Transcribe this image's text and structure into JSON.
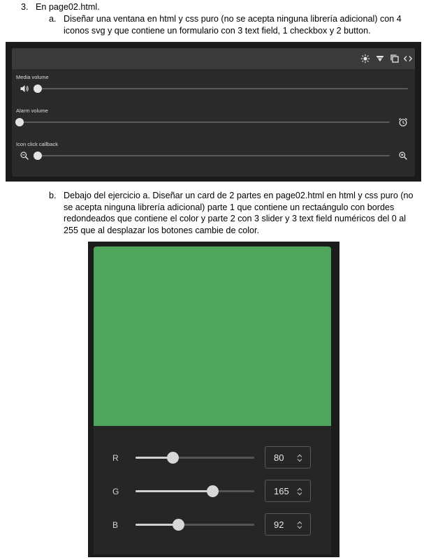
{
  "item3": {
    "marker": "3.",
    "text": "En page02.html."
  },
  "item_a": {
    "marker": "a.",
    "text": "Diseñar una ventana en html y css puro (no se acepta ninguna librería adicional) con 4 iconos svg y que contiene un formulario con 3 text field, 1 checkbox y 2 button."
  },
  "window_a": {
    "toolbar_icons": [
      "brightness-icon",
      "download-icon",
      "copy-icon",
      "code-icon"
    ],
    "rows": [
      {
        "label": "Media volume",
        "leading_icon": "volume-icon",
        "value": 0.05
      },
      {
        "label": "Alarm volume",
        "trailing_icon": "alarm-clock-icon",
        "value": 0.0
      },
      {
        "label": "Icon click callback",
        "leading_icon": "zoom-out-icon",
        "trailing_icon": "zoom-in-icon",
        "value": 0.0
      }
    ]
  },
  "item_b": {
    "marker": "b.",
    "text": "Debajo del ejercicio a. Diseñar un card de 2 partes en page02.html en html y css puro (no se acepta ninguna librería adicional) parte 1 que contiene un rectaángulo con bordes redondeados que contiene el color y parte 2 con 3 slider y 3 text field numéricos del 0 al 255 que al desplazar los botones cambie de color."
  },
  "card": {
    "color": "#50A55C",
    "channels": [
      {
        "label": "R",
        "value": "80"
      },
      {
        "label": "G",
        "value": "165"
      },
      {
        "label": "B",
        "value": "92"
      }
    ]
  }
}
